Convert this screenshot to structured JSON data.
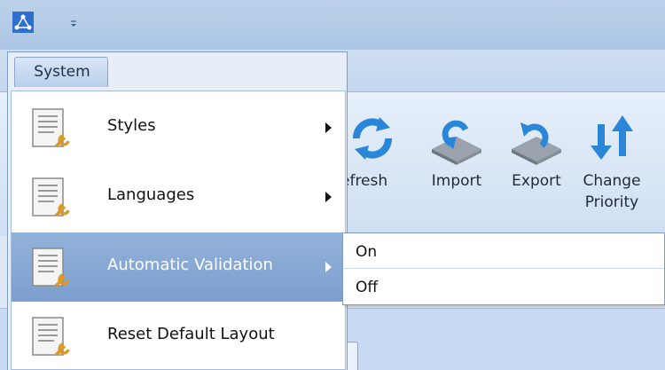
{
  "app": {
    "icon": "app-logo-icon",
    "quick_access_icon": "quick-access-dropdown-icon"
  },
  "system_menu": {
    "tab_label": "System",
    "items": [
      {
        "label": "Styles",
        "icon": "settings-document-icon",
        "has_submenu": true
      },
      {
        "label": "Languages",
        "icon": "settings-document-icon",
        "has_submenu": true
      },
      {
        "label": "Automatic Validation",
        "icon": "settings-document-icon",
        "has_submenu": true,
        "highlighted": true
      },
      {
        "label": "Reset Default Layout",
        "icon": "settings-document-icon",
        "has_submenu": false
      }
    ]
  },
  "submenu": {
    "items": [
      {
        "label": "On"
      },
      {
        "label": "Off"
      }
    ]
  },
  "ribbon": {
    "buttons": [
      {
        "label": "efresh",
        "icon": "refresh-icon"
      },
      {
        "label": "Import",
        "icon": "import-icon"
      },
      {
        "label": "Export",
        "icon": "export-icon"
      },
      {
        "label_line1": "Change",
        "label_line2": "Priority",
        "icon": "change-priority-icon"
      }
    ]
  },
  "colors": {
    "highlight": "#7c9fcf",
    "menu_border": "#7f9cc4",
    "ribbon_bg": "#cfdff2"
  }
}
